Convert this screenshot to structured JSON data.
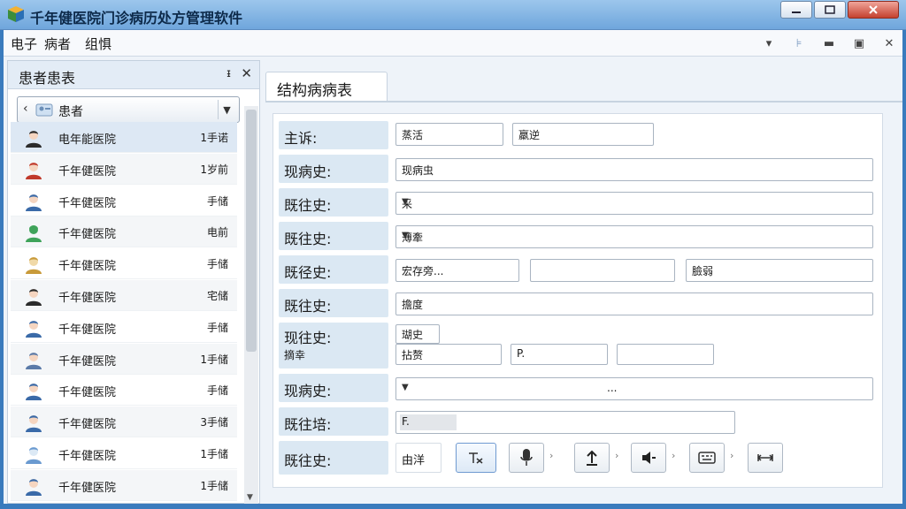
{
  "window": {
    "title": "千年健医院门诊病历处方管理软件"
  },
  "menu": {
    "items": [
      "电子",
      "病者",
      "组惧"
    ]
  },
  "left_panel": {
    "title": "患者患表",
    "pin": "ᵻ",
    "close": "✕",
    "combo_value": "患者",
    "patients": [
      {
        "name": "电年能医院",
        "status": "1手诺"
      },
      {
        "name": "千年健医院",
        "status": "1岁前"
      },
      {
        "name": "千年健医院",
        "status": "手储"
      },
      {
        "name": "千年健医院",
        "status": "电前"
      },
      {
        "name": "千年健医院",
        "status": "手储"
      },
      {
        "name": "千年健医院",
        "status": "宅储"
      },
      {
        "name": "千年健医院",
        "status": "手储"
      },
      {
        "name": "千年健医院",
        "status": "1手储"
      },
      {
        "name": "千年健医院",
        "status": "手储"
      },
      {
        "name": "千年健医院",
        "status": "3手储"
      },
      {
        "name": "千年健医院",
        "status": "1手储"
      },
      {
        "name": "千年健医院",
        "status": "1手储"
      }
    ]
  },
  "tab": {
    "label": "结构病病表"
  },
  "form": {
    "rows": [
      {
        "label": "主诉:",
        "fields": [
          "蒸活",
          "羸逆"
        ]
      },
      {
        "label": "现病史:",
        "fields": [
          "现病虫"
        ]
      },
      {
        "label": "既往史:",
        "fields": [
          "采"
        ]
      },
      {
        "label": "既往史:",
        "fields": [
          "薄牽"
        ]
      },
      {
        "label": "既径史:",
        "fields": [
          "宏存旁...",
          "",
          "臉弱"
        ]
      },
      {
        "label": "既往史:",
        "fields": [
          "擔度"
        ]
      },
      {
        "label": "现往史:",
        "label2": "摘幸",
        "fields": [
          "瑚史",
          "拈赘",
          "P.",
          ""
        ]
      },
      {
        "label": "现病史:",
        "fields": [
          "..."
        ]
      },
      {
        "label": "既往培:",
        "fields": [
          "F."
        ]
      },
      {
        "label": "既往史:",
        "fields": [
          "由洋"
        ]
      }
    ]
  },
  "toolbar_icons": [
    "text-format-icon",
    "microphone-icon",
    "upload-icon",
    "speaker-icon",
    "keyboard-icon",
    "expand-icon"
  ]
}
